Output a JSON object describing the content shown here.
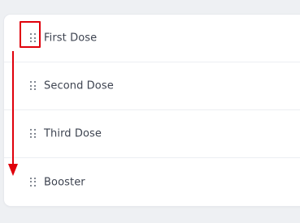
{
  "doses": {
    "items": [
      {
        "label": "First Dose"
      },
      {
        "label": "Second Dose"
      },
      {
        "label": "Third Dose"
      },
      {
        "label": "Booster"
      }
    ]
  },
  "annotation": {
    "color": "#e0000b"
  }
}
